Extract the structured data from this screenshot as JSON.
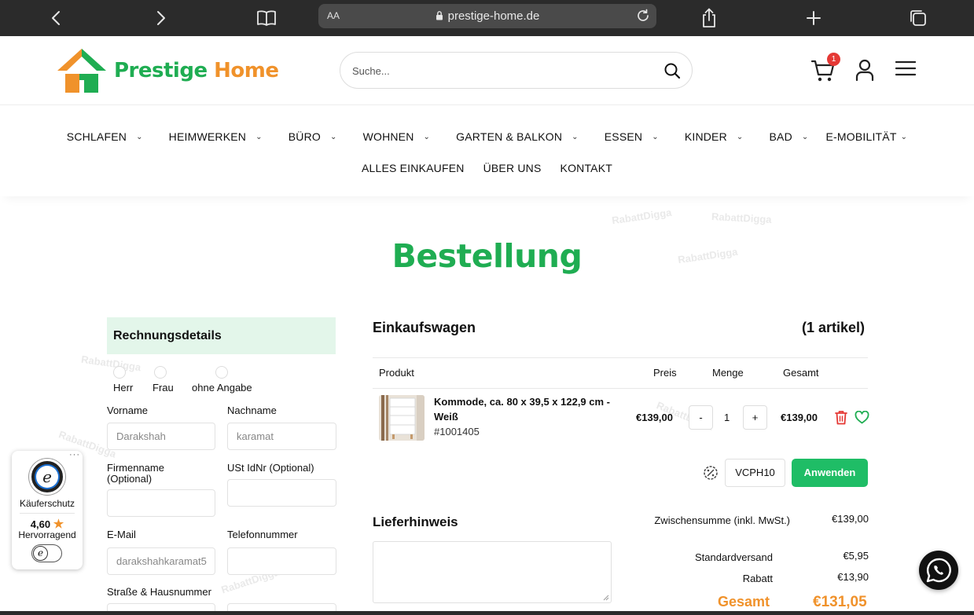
{
  "browser": {
    "text_size_label": "AA",
    "url": "prestige-home.de"
  },
  "header": {
    "logo_word1": "Prestige",
    "logo_word2": "Home",
    "search_placeholder": "Suche...",
    "cart_badge": "1"
  },
  "nav": {
    "row1": [
      "SCHLAFEN",
      "HEIMWERKEN",
      "BÜRO",
      "WOHNEN",
      "GARTEN & BALKON",
      "ESSEN",
      "KINDER",
      "BAD",
      "E-MOBILITÄT"
    ],
    "row2": [
      "ALLES EINKAUFEN",
      "ÜBER UNS",
      "KONTAKT"
    ]
  },
  "page_title": "Bestellung",
  "billing": {
    "heading": "Rechnungsdetails",
    "salutations": [
      "Herr",
      "Frau",
      "ohne Angabe"
    ],
    "first_name_label": "Vorname",
    "first_name_value": "Darakshah",
    "last_name_label": "Nachname",
    "last_name_value": "karamat",
    "company_label": "Firmenname (Optional)",
    "vat_label": "USt IdNr (Optional)",
    "email_label": "E-Mail",
    "email_value": "darakshahkaramat5",
    "phone_label": "Telefonnummer",
    "street_label": "Straße & Hausnummer"
  },
  "cart": {
    "title": "Einkaufswagen",
    "count_label": "(1 artikel)",
    "columns": [
      "Produkt",
      "Preis",
      "Menge",
      "Gesamt"
    ],
    "item": {
      "name": "Kommode, ca. 80 x 39,5 x 122,9 cm - Weiß",
      "sku": "#1001405",
      "price": "€139,00",
      "qty_minus": "-",
      "qty": "1",
      "qty_plus": "+",
      "total": "€139,00"
    },
    "coupon_code": "VCPH10",
    "apply_label": "Anwenden"
  },
  "delivery": {
    "title": "Lieferhinweis"
  },
  "summary": {
    "subtotal_label": "Zwischensumme (inkl. MwSt.)",
    "subtotal_value": "€139,00",
    "shipping_label": "Standardversand",
    "shipping_value": "€5,95",
    "discount_label": "Rabatt",
    "discount_value": "€13,90",
    "total_label": "Gesamt",
    "total_value": "€131,05"
  },
  "trust_badge": {
    "menu": "···",
    "label": "Käuferschutz",
    "rating": "4,60",
    "rating_text": "Hervorragend",
    "seal_letter": "e"
  },
  "watermark_text": "RabattDigga",
  "colors": {
    "brand_green": "#1fad52",
    "brand_orange": "#f0922b",
    "button_green": "#1fbd66",
    "badge_red": "#e53935"
  }
}
